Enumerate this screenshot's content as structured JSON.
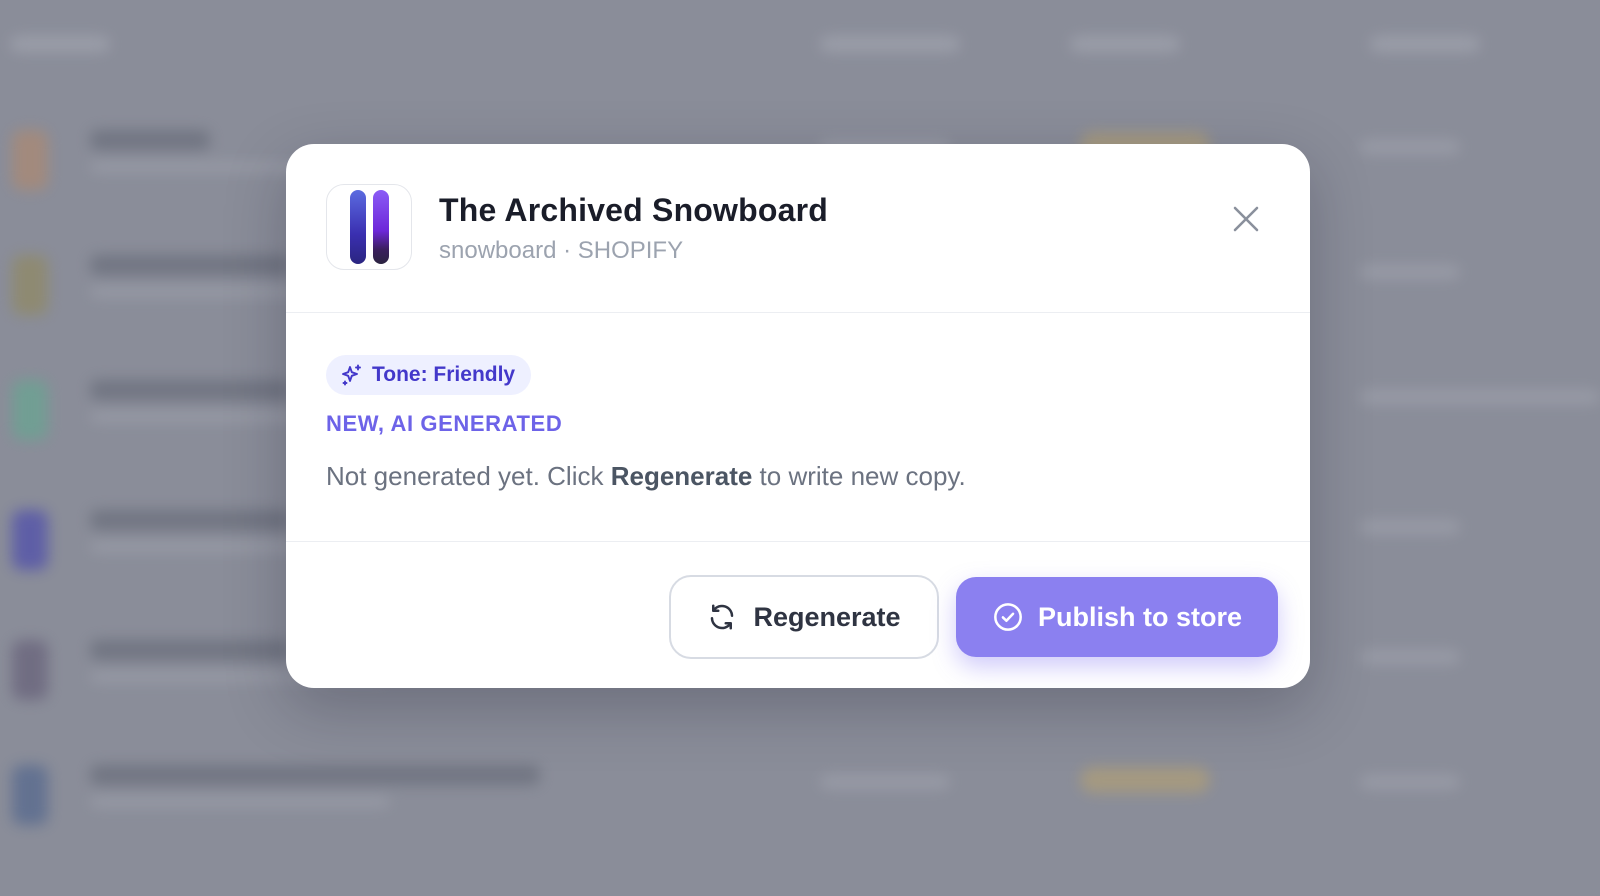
{
  "modal": {
    "product_title": "The Archived Snowboard",
    "product_subtitle": "snowboard · SHOPIFY",
    "tone_badge": "Tone: Friendly",
    "section_label": "NEW, AI GENERATED",
    "body_prefix": "Not generated yet. Click ",
    "body_bold": "Regenerate",
    "body_suffix": " to write new copy.",
    "regenerate_label": "Regenerate",
    "publish_label": "Publish to store"
  },
  "colors": {
    "accent": "#8b80f0",
    "badge_text": "#4338ca",
    "section_label": "#6d63e8"
  },
  "icons": {
    "close": "close-icon",
    "tone": "sparkles-icon",
    "regenerate": "refresh-icon",
    "publish": "check-circle-icon"
  }
}
